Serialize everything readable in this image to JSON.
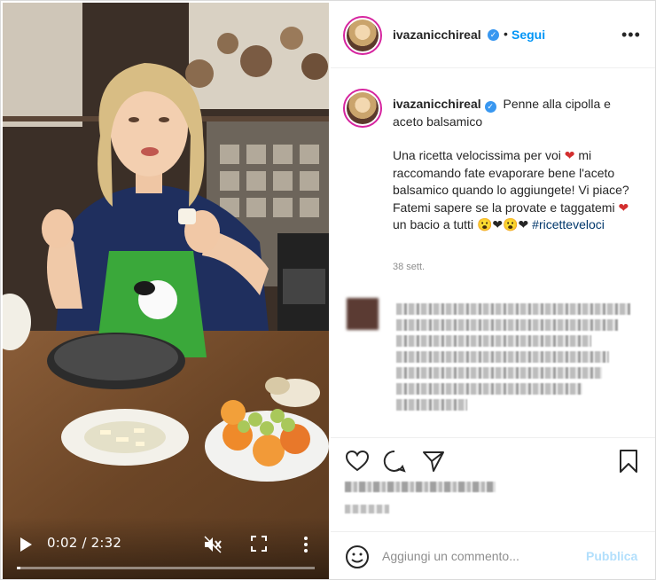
{
  "video": {
    "time_display": "0:02 / 2:32",
    "progress_fraction": 0.013
  },
  "header": {
    "username": "ivazanicchireal",
    "separator": "•",
    "follow_label": "Segui",
    "more_label": "•••"
  },
  "caption": {
    "username": "ivazanicchireal",
    "title": "Penne alla cipolla e aceto balsamico",
    "body_part1": "Una ricetta velocissima per voi",
    "heart": "❤",
    "body_part2": "mi raccomando fate evaporare bene l'aceto balsamico quando lo aggiungete! Vi piace? Fatemi sapere se la provate e taggatemi",
    "body_part3": "un bacio a tutti",
    "emojis": "😮❤😮❤",
    "hashtag": "#ricetteveloci",
    "time_ago": "38 sett."
  },
  "comment_box": {
    "placeholder": "Aggiungi un commento...",
    "publish_label": "Pubblica"
  },
  "colors": {
    "accent_blue": "#0095f6",
    "verified_blue": "#3897f0",
    "heart_red": "#d32f2f",
    "apron_green": "#3aa83a"
  }
}
